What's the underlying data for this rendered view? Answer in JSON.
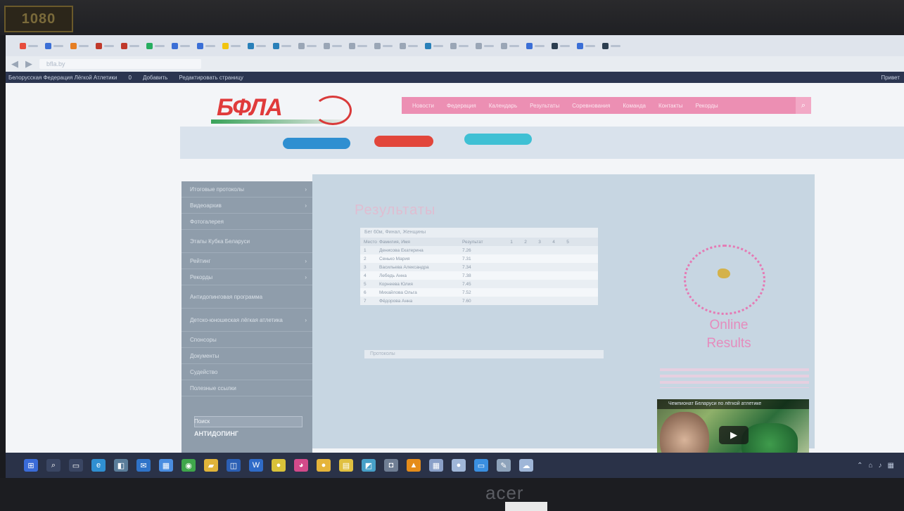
{
  "camera_label": "1080",
  "browser": {
    "tabs": [
      {
        "color": "#e74c3c"
      },
      {
        "color": "#3b6fd6"
      },
      {
        "color": "#e67e22"
      },
      {
        "color": "#c0392b"
      },
      {
        "color": "#c0392b"
      },
      {
        "color": "#27ae60"
      },
      {
        "color": "#3b6fd6"
      },
      {
        "color": "#3b6fd6"
      },
      {
        "color": "#f1c40f"
      },
      {
        "color": "#2980b9"
      },
      {
        "color": "#2980b9"
      },
      {
        "color": "#9aa6b6"
      },
      {
        "color": "#9aa6b6"
      },
      {
        "color": "#9aa6b6"
      },
      {
        "color": "#9aa6b6"
      },
      {
        "color": "#9aa6b6"
      },
      {
        "color": "#2980b9"
      },
      {
        "color": "#9aa6b6"
      },
      {
        "color": "#9aa6b6"
      },
      {
        "color": "#9aa6b6"
      },
      {
        "color": "#3b6fd6"
      },
      {
        "color": "#2c3e50"
      },
      {
        "color": "#3b6fd6"
      },
      {
        "color": "#2c3e50"
      }
    ],
    "back_icon": "◀",
    "forward_icon": "▶",
    "url": "bfla.by"
  },
  "adminbar": {
    "items": [
      "Белорусская Федерация Лёгкой Атлетики",
      "0",
      "Добавить",
      "Редактировать страницу"
    ],
    "right": "Привет"
  },
  "site": {
    "logo_text": "БФЛА",
    "nav": [
      "Новости",
      "Федерация",
      "Календарь",
      "Результаты",
      "Соревнования",
      "Команда",
      "Контакты",
      "Рекорды"
    ],
    "search_icon": "⌕",
    "sponsors": [
      {
        "color": "#2f8fd1"
      },
      {
        "color": "#e2463b"
      },
      {
        "color": "#3fc0d4"
      }
    ]
  },
  "sidebar": {
    "items": [
      {
        "label": "Итоговые протоколы",
        "arrow": "›",
        "tall": false
      },
      {
        "label": "Видеоархив",
        "arrow": "›",
        "tall": false
      },
      {
        "label": "Фотогалерея",
        "arrow": "",
        "tall": false
      },
      {
        "label": "Этапы Кубка Беларуси",
        "arrow": "",
        "tall": true
      },
      {
        "label": "Рейтинг",
        "arrow": "›",
        "tall": false
      },
      {
        "label": "Рекорды",
        "arrow": "›",
        "tall": false
      },
      {
        "label": "Антидопинговая программа",
        "arrow": "",
        "tall": true
      },
      {
        "label": "Детско-юношеская лёгкая атлетика",
        "arrow": "›",
        "tall": true
      },
      {
        "label": "Спонсоры",
        "arrow": "",
        "tall": false
      },
      {
        "label": "Документы",
        "arrow": "",
        "tall": false
      },
      {
        "label": "Судейство",
        "arrow": "",
        "tall": false
      },
      {
        "label": "Полезные ссылки",
        "arrow": "",
        "tall": false
      }
    ],
    "footer_label": "Поиск",
    "footer_strong": "АНТИДОПИНГ"
  },
  "content": {
    "title": "Результаты",
    "table": {
      "caption": "Бег 60м, Финал, Женщины",
      "headers": [
        "Место",
        "Фамилия, Имя",
        "Результат",
        "1",
        "2",
        "3",
        "4",
        "5"
      ],
      "rows": [
        {
          "rank": "1",
          "name": "Денисова Екатерина",
          "result": "7.26"
        },
        {
          "rank": "2",
          "name": "Сенько Мария",
          "result": "7.31"
        },
        {
          "rank": "3",
          "name": "Васильева Александра",
          "result": "7.34"
        },
        {
          "rank": "4",
          "name": "Лебедь Анна",
          "result": "7.38"
        },
        {
          "rank": "5",
          "name": "Корнеева Юлия",
          "result": "7.45"
        },
        {
          "rank": "6",
          "name": "Михайлова Ольга",
          "result": "7.52"
        },
        {
          "rank": "7",
          "name": "Фёдорова Анна",
          "result": "7.60"
        }
      ]
    },
    "bottom_note": "Протоколы"
  },
  "online": {
    "line1": "Online",
    "line2": "Results"
  },
  "video": {
    "title": "Чемпионат Беларуси по лёгкой атлетике",
    "play_icon": "▶"
  },
  "taskbar": {
    "icons": [
      {
        "name": "start-icon",
        "glyph": "⊞",
        "color": "#3a6bd8"
      },
      {
        "name": "search-icon",
        "glyph": "⌕",
        "color": "#3a4663"
      },
      {
        "name": "task-view-icon",
        "glyph": "▭",
        "color": "#3a4663"
      },
      {
        "name": "edge-icon",
        "glyph": "e",
        "color": "#2f8fd1"
      },
      {
        "name": "store-icon",
        "glyph": "◧",
        "color": "#5a7d9a"
      },
      {
        "name": "mail-icon",
        "glyph": "✉",
        "color": "#2f73c8"
      },
      {
        "name": "network-icon",
        "glyph": "▦",
        "color": "#4a8de0"
      },
      {
        "name": "chrome-icon",
        "glyph": "◉",
        "color": "#3fa64b"
      },
      {
        "name": "explorer-icon",
        "glyph": "▰",
        "color": "#e0b43a"
      },
      {
        "name": "outlook-icon",
        "glyph": "◫",
        "color": "#2b5fb4"
      },
      {
        "name": "word-icon",
        "glyph": "W",
        "color": "#2f6bc8"
      },
      {
        "name": "sticky-icon",
        "glyph": "●",
        "color": "#d8c23a"
      },
      {
        "name": "media-icon",
        "glyph": "◕",
        "color": "#d24a8a"
      },
      {
        "name": "norton-icon",
        "glyph": "●",
        "color": "#e5b43a"
      },
      {
        "name": "notes-icon",
        "glyph": "▤",
        "color": "#e0c040"
      },
      {
        "name": "photos-icon",
        "glyph": "◩",
        "color": "#47a0c8"
      },
      {
        "name": "camera-icon",
        "glyph": "◘",
        "color": "#6f7e94"
      },
      {
        "name": "vlc-icon",
        "glyph": "▲",
        "color": "#e58c1a"
      },
      {
        "name": "calc-icon",
        "glyph": "▦",
        "color": "#8aa0c8"
      },
      {
        "name": "chat-icon",
        "glyph": "●",
        "color": "#9fb6d8"
      },
      {
        "name": "monitor-icon",
        "glyph": "▭",
        "color": "#3a8fe0"
      },
      {
        "name": "tools-icon",
        "glyph": "✎",
        "color": "#8ea3bb"
      },
      {
        "name": "cloud-icon",
        "glyph": "☁",
        "color": "#9fb6d8"
      }
    ],
    "tray": [
      "⌃",
      "⌂",
      "♪",
      "▦"
    ]
  },
  "monitor_brand": "acer"
}
